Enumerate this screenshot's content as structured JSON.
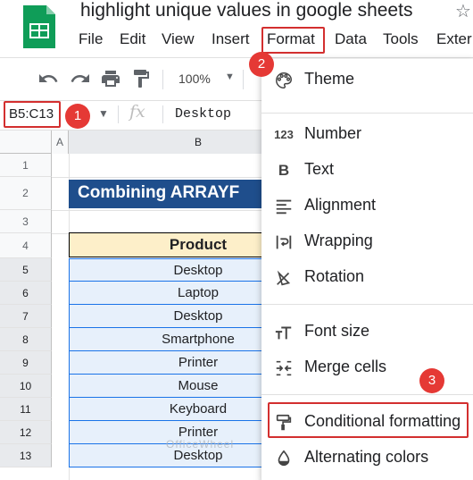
{
  "app": {
    "doc_title": "highlight unique values in google sheets",
    "menus": [
      "File",
      "Edit",
      "View",
      "Insert",
      "Format",
      "Data",
      "Tools",
      "Exter"
    ]
  },
  "toolbar": {
    "zoom": "100%"
  },
  "formula_bar": {
    "name_box": "B5:C13",
    "fx": "fx",
    "value": "Desktop"
  },
  "grid": {
    "columns": [
      "A",
      "B"
    ],
    "rows": [
      "1",
      "2",
      "3",
      "4",
      "5",
      "6",
      "7",
      "8",
      "9",
      "10",
      "11",
      "12",
      "13"
    ],
    "title_text": "Combining ARRAYF",
    "header": "Product",
    "cells": [
      "Desktop",
      "Laptop",
      "Desktop",
      "Smartphone",
      "Printer",
      "Mouse",
      "Keyboard",
      "Printer",
      "Desktop"
    ],
    "watermark": "OfficeWheel"
  },
  "format_menu": {
    "items": [
      {
        "label": "Theme",
        "icon": "palette-icon"
      },
      {
        "label": "Number",
        "icon": "number-format-icon"
      },
      {
        "label": "Text",
        "icon": "bold-icon"
      },
      {
        "label": "Alignment",
        "icon": "align-icon"
      },
      {
        "label": "Wrapping",
        "icon": "wrap-icon"
      },
      {
        "label": "Rotation",
        "icon": "rotate-icon"
      },
      {
        "label": "Font size",
        "icon": "font-size-icon"
      },
      {
        "label": "Merge cells",
        "icon": "merge-icon"
      },
      {
        "label": "Conditional formatting",
        "icon": "paint-roller-icon"
      },
      {
        "label": "Alternating colors",
        "icon": "fill-drop-icon"
      }
    ],
    "number_glyph": "123"
  },
  "badges": [
    "1",
    "2",
    "3"
  ],
  "colors": {
    "highlight_red": "#d32f2f",
    "badge_red": "#e53935",
    "title_fill": "#1f4e8c",
    "header_fill": "#fdefc9",
    "selection_fill": "#e7f0fb",
    "selection_border": "#1a73e8",
    "sheets_green": "#0f9d58"
  }
}
